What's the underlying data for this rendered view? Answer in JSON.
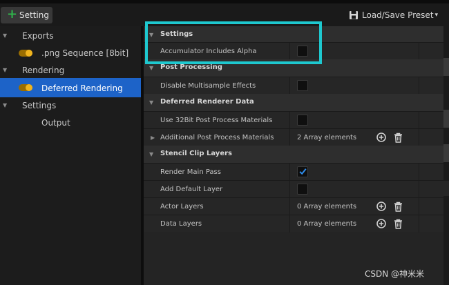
{
  "toolbar": {
    "add_label": "Setting",
    "preset_label": "Load/Save Preset",
    "preset_caret": "▾"
  },
  "sidebar": {
    "items": [
      {
        "label": "Exports",
        "expanded": true,
        "icon": "tree-arrow-icon"
      },
      {
        "label": ".png Sequence [8bit]",
        "toggle": true,
        "icon": "toggle-icon"
      },
      {
        "label": "Rendering",
        "expanded": true,
        "icon": "tree-arrow-icon"
      },
      {
        "label": "Deferred Rendering",
        "toggle": true,
        "selected": true,
        "icon": "toggle-icon"
      },
      {
        "label": "Settings",
        "expanded": true,
        "icon": "tree-arrow-icon"
      },
      {
        "label": "Output"
      }
    ]
  },
  "details": {
    "categories": [
      {
        "title": "Settings",
        "properties": [
          {
            "label": "Accumulator Includes Alpha",
            "type": "checkbox",
            "checked": false
          }
        ]
      },
      {
        "title": "Post Processing",
        "properties": [
          {
            "label": "Disable Multisample Effects",
            "type": "checkbox",
            "checked": false
          }
        ]
      },
      {
        "title": "Deferred Renderer Data",
        "properties": [
          {
            "label": "Use 32Bit Post Process Materials",
            "type": "checkbox",
            "checked": false
          },
          {
            "label": "Additional Post Process Materials",
            "type": "array",
            "value": "2 Array elements"
          }
        ]
      },
      {
        "title": "Stencil Clip Layers",
        "properties": [
          {
            "label": "Render Main Pass",
            "type": "checkbox",
            "checked": true
          },
          {
            "label": "Add Default Layer",
            "type": "checkbox",
            "checked": false
          },
          {
            "label": "Actor Layers",
            "type": "array",
            "value": "0 Array elements"
          },
          {
            "label": "Data Layers",
            "type": "array",
            "value": "0 Array elements"
          }
        ]
      }
    ]
  },
  "colors": {
    "accent": "#1d63c8",
    "highlight": "#1ec8cf",
    "toggle_on": "#f0b41e",
    "add_green": "#2fb34b"
  },
  "watermark": "CSDN @神米米"
}
